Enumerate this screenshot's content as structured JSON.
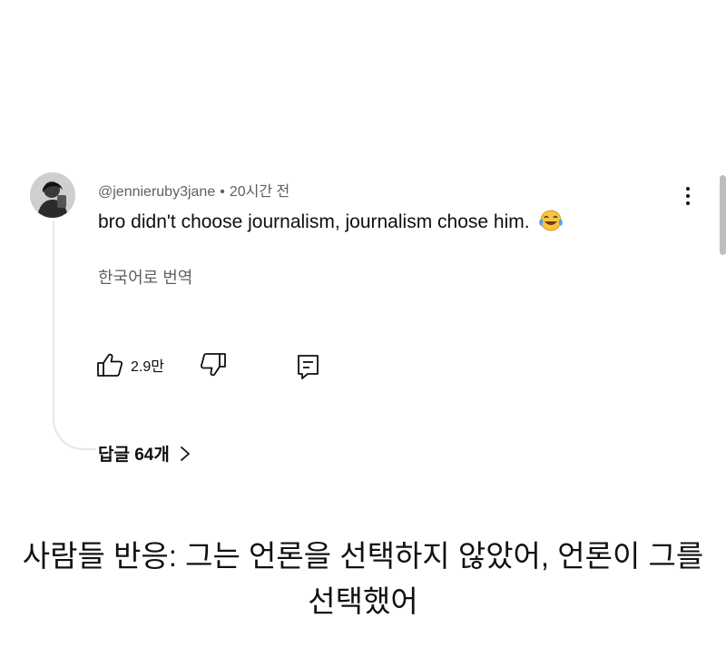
{
  "comment": {
    "handle": "@jennieruby3jane",
    "separator": "•",
    "time_ago": "20시간 전",
    "text": "bro didn't choose journalism, journalism chose him.",
    "emoji_icon": "tears-of-joy-emoji",
    "translate_label": "한국어로 번역",
    "like_count": "2.9만",
    "replies_label": "답글 64개",
    "icons": [
      "avatar",
      "more-vert-icon",
      "thumbs-up-icon",
      "thumbs-down-icon",
      "reply-icon",
      "chevron-right-icon"
    ]
  },
  "caption": {
    "line1": "사람들 반응: 그는 언론을 선택하지 않았어, 언론이 그를",
    "line2": "선택했어"
  }
}
